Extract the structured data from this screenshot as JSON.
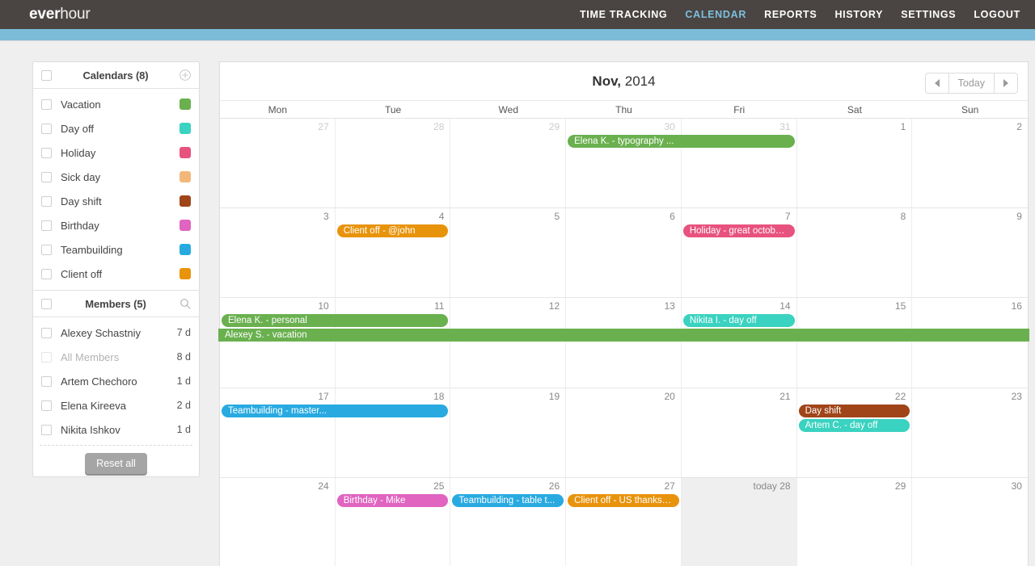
{
  "brand": {
    "bold": "ever",
    "light": "hour"
  },
  "nav": [
    {
      "label": "TIME TRACKING",
      "active": false
    },
    {
      "label": "CALENDAR",
      "active": true
    },
    {
      "label": "REPORTS",
      "active": false
    },
    {
      "label": "HISTORY",
      "active": false
    },
    {
      "label": "SETTINGS",
      "active": false
    },
    {
      "label": "LOGOUT",
      "active": false
    }
  ],
  "sidebar": {
    "calendars_header": "Calendars (8)",
    "calendars": [
      {
        "label": "Vacation",
        "color": "#6ab04f"
      },
      {
        "label": "Day off",
        "color": "#3ad2c0"
      },
      {
        "label": "Holiday",
        "color": "#e8527e"
      },
      {
        "label": "Sick day",
        "color": "#f3b879"
      },
      {
        "label": "Day shift",
        "color": "#a0451a"
      },
      {
        "label": "Birthday",
        "color": "#e064c0"
      },
      {
        "label": "Teambuilding",
        "color": "#28aae1"
      },
      {
        "label": "Client off",
        "color": "#e8930c"
      }
    ],
    "members_header": "Members (5)",
    "members": [
      {
        "name": "Alexey Schastniy",
        "days": "7 d",
        "dim": false
      },
      {
        "name": "All Members",
        "days": "8 d",
        "dim": true
      },
      {
        "name": "Artem Chechoro",
        "days": "1 d",
        "dim": false
      },
      {
        "name": "Elena Kireeva",
        "days": "2 d",
        "dim": false
      },
      {
        "name": "Nikita Ishkov",
        "days": "1 d",
        "dim": false
      }
    ],
    "reset_label": "Reset all"
  },
  "calendar": {
    "month": "Nov,",
    "year": "2014",
    "today_label": "Today",
    "dow": [
      "Mon",
      "Tue",
      "Wed",
      "Thu",
      "Fri",
      "Sat",
      "Sun"
    ],
    "weeks": [
      {
        "days": [
          {
            "num": "27",
            "out": true
          },
          {
            "num": "28",
            "out": true
          },
          {
            "num": "29",
            "out": true
          },
          {
            "num": "30",
            "out": true
          },
          {
            "num": "31",
            "out": true
          },
          {
            "num": "1",
            "out": false
          },
          {
            "num": "2",
            "out": false
          }
        ],
        "events": [
          {
            "title": "Elena K. - typography ...",
            "color": "#6ab04f",
            "start": 3,
            "span": 2,
            "row": 0
          }
        ]
      },
      {
        "days": [
          {
            "num": "3",
            "out": false
          },
          {
            "num": "4",
            "out": false
          },
          {
            "num": "5",
            "out": false
          },
          {
            "num": "6",
            "out": false
          },
          {
            "num": "7",
            "out": false
          },
          {
            "num": "8",
            "out": false
          },
          {
            "num": "9",
            "out": false
          }
        ],
        "events": [
          {
            "title": "Client off - @john",
            "color": "#e8930c",
            "start": 1,
            "span": 1,
            "row": 0
          },
          {
            "title": "Holiday - great octobe...",
            "color": "#e8527e",
            "start": 4,
            "span": 1,
            "row": 0
          }
        ]
      },
      {
        "days": [
          {
            "num": "10",
            "out": false
          },
          {
            "num": "11",
            "out": false
          },
          {
            "num": "12",
            "out": false
          },
          {
            "num": "13",
            "out": false
          },
          {
            "num": "14",
            "out": false
          },
          {
            "num": "15",
            "out": false
          },
          {
            "num": "16",
            "out": false
          }
        ],
        "events": [
          {
            "title": "Elena K. - personal",
            "color": "#6ab04f",
            "start": 0,
            "span": 2,
            "row": 0
          },
          {
            "title": "Nikita I. - day off",
            "color": "#3ad2c0",
            "start": 4,
            "span": 1,
            "row": 0
          },
          {
            "title": "Alexey S. - vacation",
            "color": "#6ab04f",
            "start": 0,
            "span": 7,
            "row": 1,
            "bleed": true
          }
        ]
      },
      {
        "days": [
          {
            "num": "17",
            "out": false
          },
          {
            "num": "18",
            "out": false
          },
          {
            "num": "19",
            "out": false
          },
          {
            "num": "20",
            "out": false
          },
          {
            "num": "21",
            "out": false
          },
          {
            "num": "22",
            "out": false
          },
          {
            "num": "23",
            "out": false
          }
        ],
        "events": [
          {
            "title": "Teambuilding - master...",
            "color": "#28aae1",
            "start": 0,
            "span": 2,
            "row": 0
          },
          {
            "title": "Day shift",
            "color": "#a0451a",
            "start": 5,
            "span": 1,
            "row": 0
          },
          {
            "title": "Artem C. - day off",
            "color": "#3ad2c0",
            "start": 5,
            "span": 1,
            "row": 1
          }
        ]
      },
      {
        "days": [
          {
            "num": "24",
            "out": false
          },
          {
            "num": "25",
            "out": false
          },
          {
            "num": "26",
            "out": false
          },
          {
            "num": "27",
            "out": false
          },
          {
            "num": "today 28",
            "out": false,
            "today": true
          },
          {
            "num": "29",
            "out": false
          },
          {
            "num": "30",
            "out": false
          }
        ],
        "events": [
          {
            "title": "Birthday - Mike",
            "color": "#e064c0",
            "start": 1,
            "span": 1,
            "row": 0
          },
          {
            "title": "Teambuilding - table t...",
            "color": "#28aae1",
            "start": 2,
            "span": 1,
            "row": 0
          },
          {
            "title": "Client off - US thanksg...",
            "color": "#e8930c",
            "start": 3,
            "span": 1,
            "row": 0
          }
        ]
      }
    ]
  }
}
